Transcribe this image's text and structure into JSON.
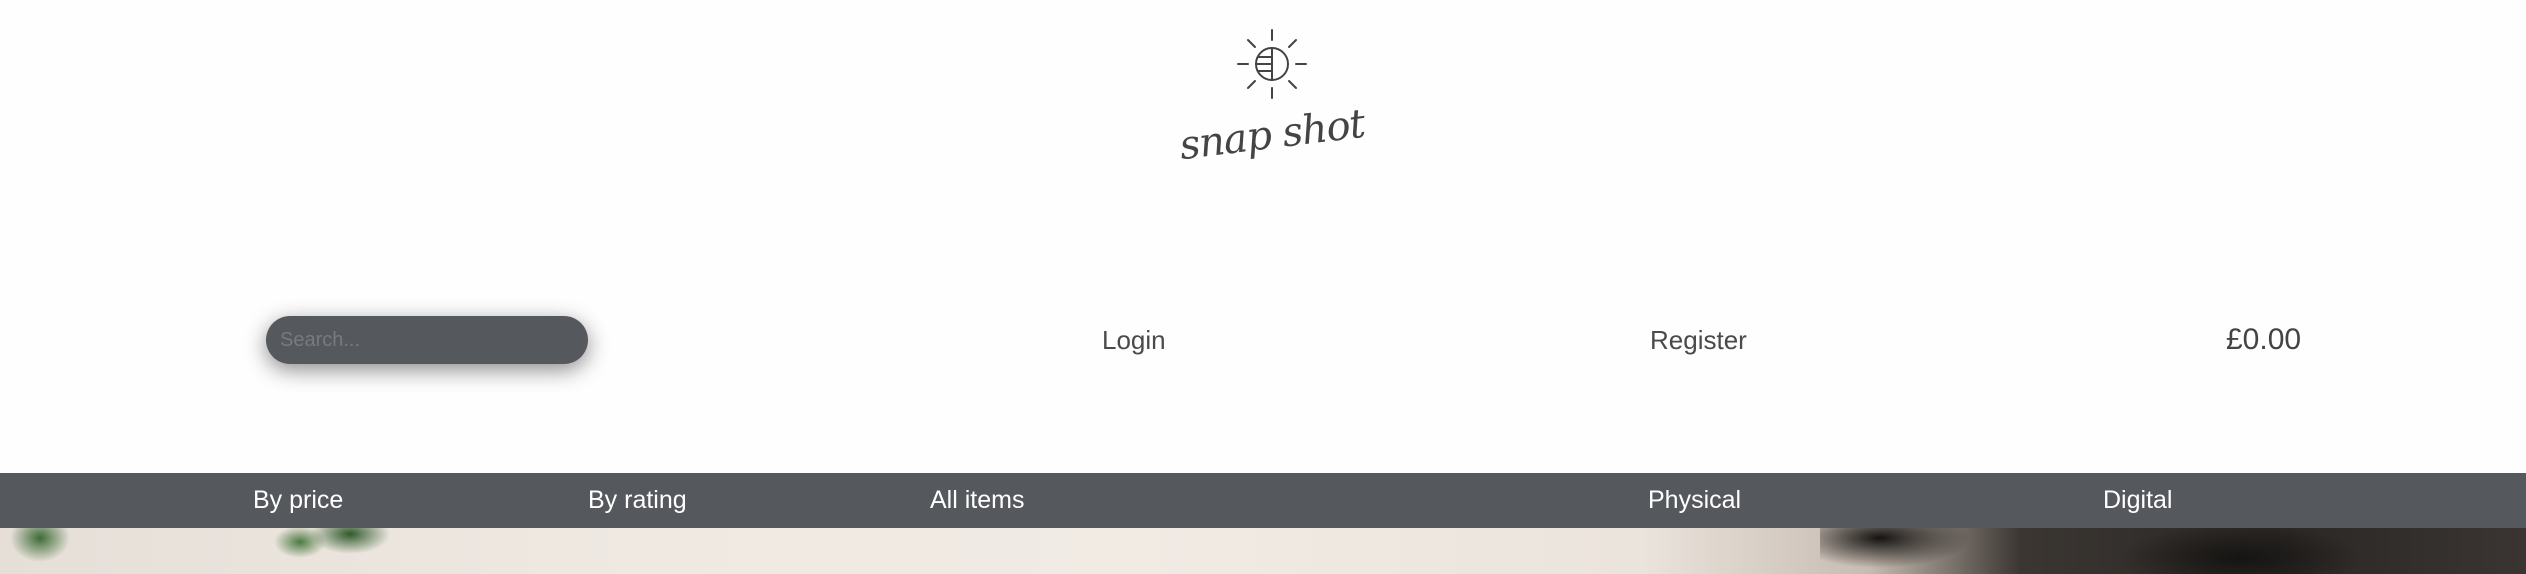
{
  "header": {
    "logo": {
      "icon": "sun-globe-icon",
      "text": "snap shot"
    },
    "search": {
      "placeholder": "Search..."
    },
    "login_label": "Login",
    "register_label": "Register",
    "cart_total": "£0.00"
  },
  "nav": {
    "items": [
      {
        "label": "By price"
      },
      {
        "label": "By rating"
      },
      {
        "label": "All items"
      },
      {
        "label": "Physical"
      },
      {
        "label": "Digital"
      }
    ]
  },
  "colors": {
    "nav_background": "#55585d",
    "search_background": "#55585d",
    "nav_text": "#ffffff",
    "page_background": "#fefefe"
  }
}
